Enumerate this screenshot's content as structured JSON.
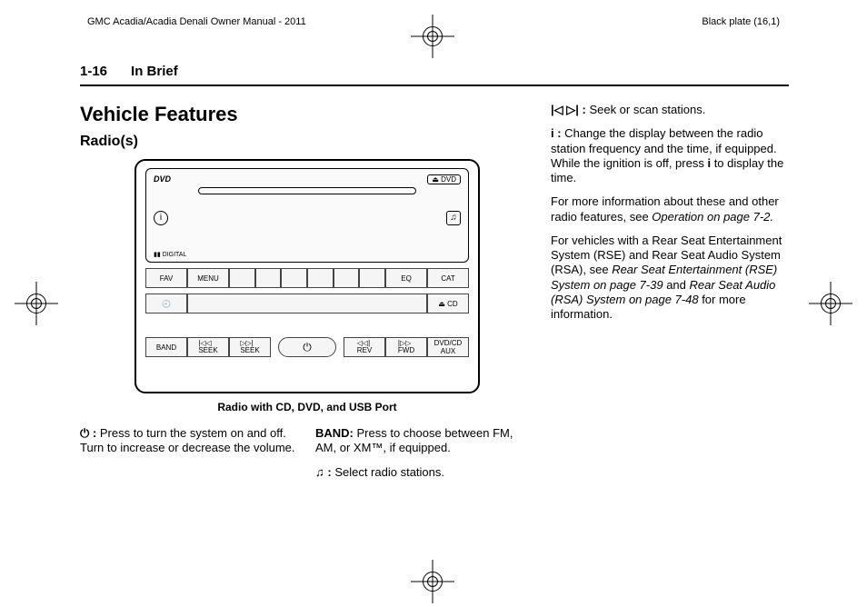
{
  "header": {
    "manual": "GMC Acadia/Acadia Denali Owner Manual - 2011",
    "plate": "Black plate (16,1)"
  },
  "runhead": {
    "pagenum": "1-16",
    "section": "In Brief"
  },
  "headings": {
    "h1": "Vehicle Features",
    "h2": "Radio(s)"
  },
  "figure": {
    "caption": "Radio with CD, DVD, and USB Port",
    "labels": {
      "dvd_logo": "DVD",
      "dvd_eject": "⏏ DVD",
      "info": "i",
      "music": "♫",
      "dolby": "▮▮ DIGITAL",
      "fav": "FAV",
      "menu": "MENU",
      "eq": "EQ",
      "cat": "CAT",
      "clock": "🕘",
      "cd_eject": "⏏ CD",
      "band": "BAND",
      "seek_prev": "|◁◁\nSEEK",
      "seek_next": "▷▷|\nSEEK",
      "power": "⏻",
      "rev": "◁◁|\nREV",
      "fwd": "|▷▷\nFWD",
      "aux": "DVD/CD\nAUX"
    }
  },
  "body": {
    "power_sym": "⏻ :",
    "power_txt": "  Press to turn the system on and off. Turn to increase or decrease the volume.",
    "band_label": "BAND:",
    "band_txt": "  Press to choose between FM, AM, or XM™, if equipped.",
    "tune_sym": "♫ :",
    "tune_txt": "  Select radio stations.",
    "seek_sym": "|◁ ▷| :",
    "seek_txt": "  Seek or scan stations.",
    "info_sym": "i :",
    "info_txt_a": "  Change the display between the radio station frequency and the time, if equipped. While the ignition is off, press ",
    "info_sym2": "i",
    "info_txt_b": " to display the time.",
    "more1a": "For more information about these and other radio features, see ",
    "more1b": "Operation on page 7-2.",
    "more2a": "For vehicles with a Rear Seat Entertainment System (RSE) and Rear Seat Audio System (RSA), see ",
    "more2b": "Rear Seat Entertainment (RSE) System on page 7-39",
    "more2c": " and ",
    "more2d": "Rear Seat Audio (RSA) System on page 7-48",
    "more2e": " for more information."
  }
}
